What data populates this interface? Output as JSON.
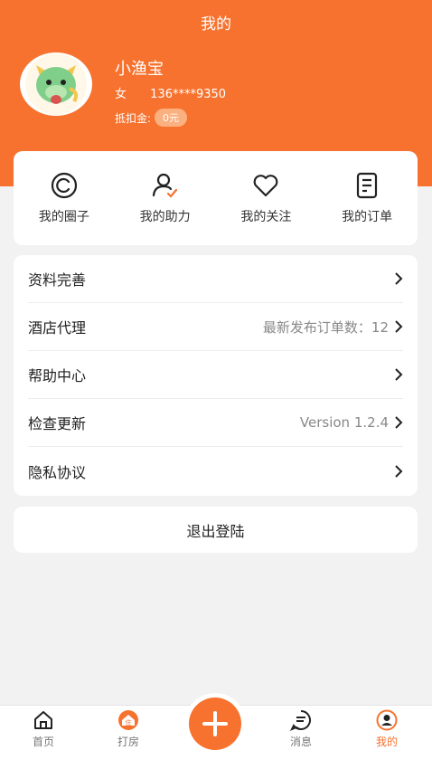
{
  "header": {
    "title": "我的"
  },
  "profile": {
    "name": "小渔宝",
    "gender": "女",
    "phone": "136****9350",
    "deduct_label": "抵扣金:",
    "deduct_value": "0元",
    "avatar_icon": "dragon-avatar-icon"
  },
  "quick_actions": [
    {
      "label": "我的圈子",
      "icon": "circle-icon"
    },
    {
      "label": "我的助力",
      "icon": "user-check-icon"
    },
    {
      "label": "我的关注",
      "icon": "heart-icon"
    },
    {
      "label": "我的订单",
      "icon": "order-list-icon"
    }
  ],
  "menu": [
    {
      "title": "资料完善",
      "value": ""
    },
    {
      "title": "酒店代理",
      "value": "最新发布订单数：12"
    },
    {
      "title": "帮助中心",
      "value": ""
    },
    {
      "title": "检查更新",
      "value": "Version 1.2.4"
    },
    {
      "title": "隐私协议",
      "value": ""
    }
  ],
  "logout_label": "退出登陆",
  "tabbar": {
    "home": "首页",
    "checkin": "打房",
    "messages": "消息",
    "mine": "我的"
  },
  "colors": {
    "accent": "#f7722e",
    "background": "#f2f2f2"
  }
}
